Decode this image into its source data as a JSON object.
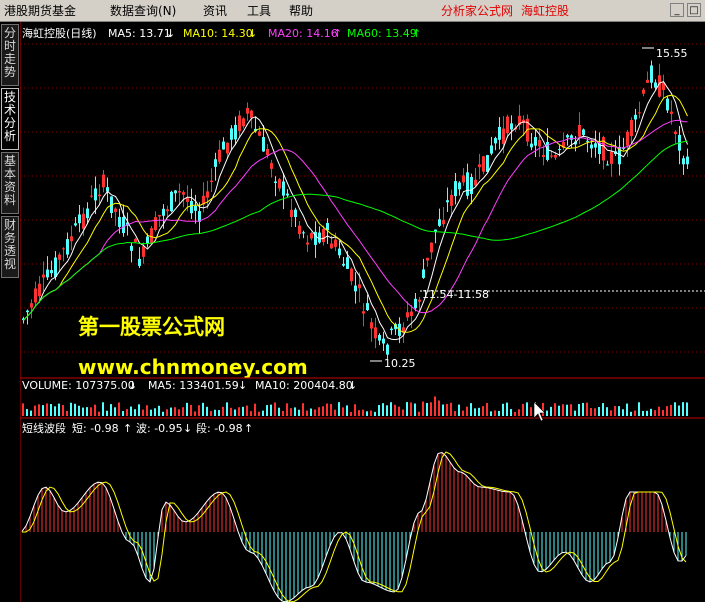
{
  "menu": {
    "items": [
      "港股期货基金",
      "数据查询(N)",
      "资讯",
      "工具",
      "帮助"
    ],
    "right_links": [
      "分析家公式网",
      "海虹控股"
    ],
    "window_buttons": [
      "_",
      "□"
    ]
  },
  "side_tabs": [
    "分时走势",
    "技术分析",
    "基本资料",
    "财务透视"
  ],
  "main_panel": {
    "stock_title": "海虹控股(日线)",
    "ma_labels": [
      {
        "text": "MA5: 13.71",
        "arrow": "↓",
        "color": "#ffffff"
      },
      {
        "text": "MA10: 14.30",
        "arrow": "↓",
        "color": "#ffff00"
      },
      {
        "text": "MA20: 14.16",
        "arrow": "↑",
        "color": "#ff40ff"
      },
      {
        "text": "MA60: 13.49",
        "arrow": "↑",
        "color": "#00ff00"
      }
    ],
    "annotations": [
      "15.55",
      "11.54-11.58",
      "10.25"
    ]
  },
  "watermark": {
    "line1": "第一股票公式网",
    "line2": "www.chnmoney.com"
  },
  "volume_panel": {
    "labels": [
      {
        "text": "VOLUME: 107375.00",
        "arrow": "↓",
        "color": "#ffffff"
      },
      {
        "text": "MA5: 133401.59",
        "arrow": "↓",
        "color": "#ffffff"
      },
      {
        "text": "MA10: 200404.80",
        "arrow": "↓",
        "color": "#ffffff"
      }
    ]
  },
  "indicator_panel": {
    "name": "短线波段",
    "labels": [
      {
        "text": "短: -0.98",
        "arrow": "↑",
        "color": "#ffffff"
      },
      {
        "text": "波: -0.95",
        "arrow": "↓",
        "color": "#ffffff"
      },
      {
        "text": "段: -0.98",
        "arrow": "↑",
        "color": "#ffffff"
      }
    ]
  },
  "colors": {
    "up": "#ff3232",
    "down": "#54ffff",
    "ma5": "#ffffff",
    "ma10": "#ffff00",
    "ma20": "#ff40ff",
    "ma60": "#00ff00",
    "grid": "#800000",
    "watermark": "#ffff00"
  }
}
